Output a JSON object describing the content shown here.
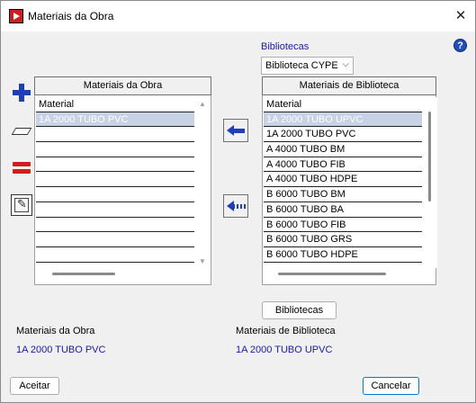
{
  "window": {
    "title": "Materiais da Obra",
    "close_glyph": "✕"
  },
  "help": {
    "glyph": "?"
  },
  "library": {
    "label": "Bibliotecas",
    "selected": "Biblioteca CYPE",
    "chevron": "⌵"
  },
  "left_panel": {
    "title": "Materiais da Obra",
    "column": "Material",
    "rows": [
      "1A 2000 TUBO PVC",
      "",
      "",
      "",
      "",
      "",
      "",
      "",
      "",
      ""
    ]
  },
  "right_panel": {
    "title": "Materiais de Biblioteca",
    "column": "Material",
    "rows": [
      "1A 2000 TUBO UPVC",
      "1A 2000 TUBO PVC",
      "A 4000 TUBO BM",
      "A 4000 TUBO FIB",
      "A 4000 TUBO HDPE",
      "B 6000 TUBO BM",
      "B 6000 TUBO BA",
      "B 6000 TUBO FIB",
      "B 6000 TUBO GRS",
      "B 6000 TUBO HDPE"
    ]
  },
  "buttons": {
    "bibliotecas": "Bibliotecas",
    "aceitar": "Aceitar",
    "cancelar": "Cancelar"
  },
  "info": {
    "obra_label": "Materiais da Obra",
    "obra_value": "1A 2000 TUBO PVC",
    "biblioteca_label": "Materiais de Biblioteca",
    "biblioteca_value": "1A 2000 TUBO UPVC"
  },
  "scroll_arrows": {
    "up": "▲",
    "down": "▼"
  }
}
